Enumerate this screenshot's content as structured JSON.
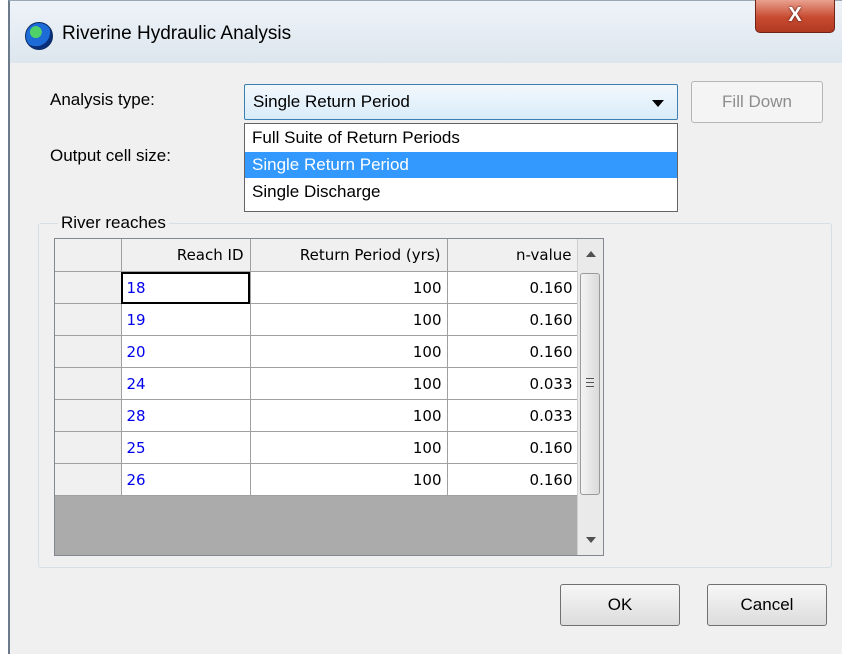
{
  "window": {
    "title": "Riverine Hydraulic Analysis",
    "close_label": "X"
  },
  "form": {
    "analysis_type_label": "Analysis type:",
    "output_cell_size_label": "Output cell size:",
    "analysis_type_value": "Single Return Period",
    "fill_down_label": "Fill Down"
  },
  "dropdown": {
    "options": [
      "Full Suite of Return Periods",
      "Single Return Period",
      "Single Discharge"
    ],
    "selected_index": 1
  },
  "group": {
    "label": "River reaches"
  },
  "table": {
    "columns": [
      "Reach ID",
      "Return Period (yrs)",
      "n-value"
    ],
    "rows": [
      {
        "reach_id": "18",
        "return_period": "100",
        "n_value": "0.160"
      },
      {
        "reach_id": "19",
        "return_period": "100",
        "n_value": "0.160"
      },
      {
        "reach_id": "20",
        "return_period": "100",
        "n_value": "0.160"
      },
      {
        "reach_id": "24",
        "return_period": "100",
        "n_value": "0.033"
      },
      {
        "reach_id": "28",
        "return_period": "100",
        "n_value": "0.033"
      },
      {
        "reach_id": "25",
        "return_period": "100",
        "n_value": "0.160"
      },
      {
        "reach_id": "26",
        "return_period": "100",
        "n_value": "0.160"
      }
    ]
  },
  "buttons": {
    "ok_label": "OK",
    "cancel_label": "Cancel"
  },
  "colors": {
    "selection": "#3399ff",
    "id_link": "#0000ee"
  }
}
